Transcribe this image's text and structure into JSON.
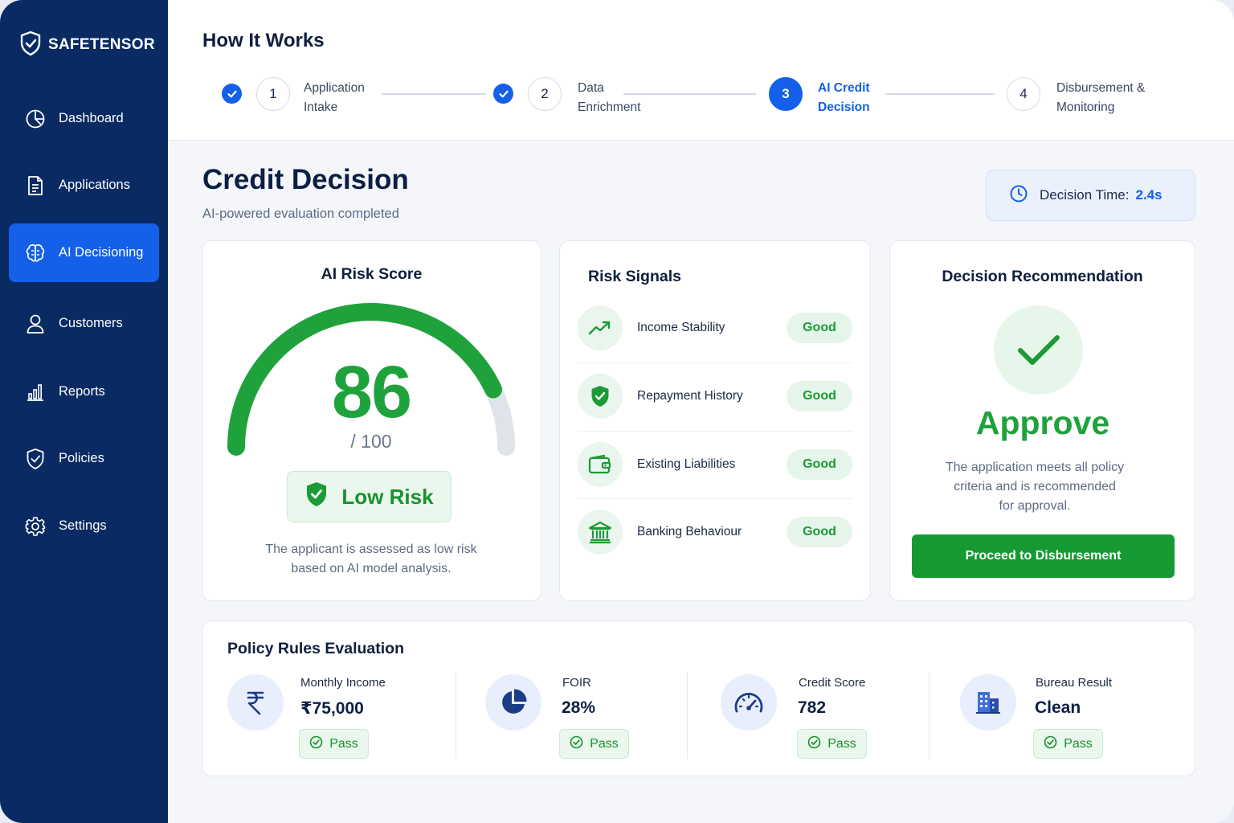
{
  "brand": {
    "name": "SAFETENSOR"
  },
  "sidebar": {
    "items": [
      {
        "label": "Dashboard",
        "icon": "pie-chart-icon",
        "active": false
      },
      {
        "label": "Applications",
        "icon": "document-icon",
        "active": false
      },
      {
        "label": "AI Decisioning",
        "icon": "brain-icon",
        "active": true
      },
      {
        "label": "Customers",
        "icon": "user-icon",
        "active": false
      },
      {
        "label": "Reports",
        "icon": "bar-chart-icon",
        "active": false
      },
      {
        "label": "Policies",
        "icon": "shield-icon",
        "active": false
      },
      {
        "label": "Settings",
        "icon": "gear-icon",
        "active": false
      }
    ]
  },
  "how_it_works": {
    "title": "How It Works",
    "steps": [
      {
        "number": "1",
        "line1": "Application",
        "line2": "Intake",
        "status": "completed"
      },
      {
        "number": "2",
        "line1": "Data",
        "line2": "Enrichment",
        "status": "completed"
      },
      {
        "number": "3",
        "line1": "AI Credit",
        "line2": "Decision",
        "status": "active"
      },
      {
        "number": "4",
        "line1": "Disbursement &",
        "line2": "Monitoring",
        "status": "pending"
      }
    ]
  },
  "page": {
    "title": "Credit Decision",
    "subtitle": "AI-powered evaluation completed",
    "decision_time_label": "Decision Time:",
    "decision_time_value": "2.4s"
  },
  "risk_score": {
    "title": "AI Risk Score",
    "score": "86",
    "max": "/ 100",
    "score_fraction": 0.86,
    "level": "Low Risk",
    "note_line1": "The applicant is assessed as low risk",
    "note_line2": "based on AI model analysis."
  },
  "risk_signals": {
    "title": "Risk Signals",
    "items": [
      {
        "label": "Income Stability",
        "status": "Good",
        "icon": "trending-up-icon"
      },
      {
        "label": "Repayment History",
        "status": "Good",
        "icon": "shield-check-icon"
      },
      {
        "label": "Existing Liabilities",
        "status": "Good",
        "icon": "wallet-icon"
      },
      {
        "label": "Banking Behaviour",
        "status": "Good",
        "icon": "bank-icon"
      }
    ]
  },
  "recommendation": {
    "title": "Decision Recommendation",
    "decision": "Approve",
    "note_line1": "The application meets all policy",
    "note_line2": "criteria and is recommended",
    "note_line3": "for approval.",
    "button_label": "Proceed to Disbursement"
  },
  "policy_rules": {
    "title": "Policy Rules Evaluation",
    "items": [
      {
        "label": "Monthly Income",
        "value": "₹75,000",
        "status": "Pass",
        "icon": "rupee-icon"
      },
      {
        "label": "FOIR",
        "value": "28%",
        "status": "Pass",
        "icon": "pie-icon"
      },
      {
        "label": "Credit Score",
        "value": "782",
        "status": "Pass",
        "icon": "speedometer-icon"
      },
      {
        "label": "Bureau Result",
        "value": "Clean",
        "status": "Pass",
        "icon": "building-icon"
      }
    ]
  },
  "colors": {
    "sidebar_bg": "#0a2a63",
    "accent_blue": "#1560e8",
    "success_green": "#1fa23c",
    "gauge_track": "#dfe3ea"
  }
}
